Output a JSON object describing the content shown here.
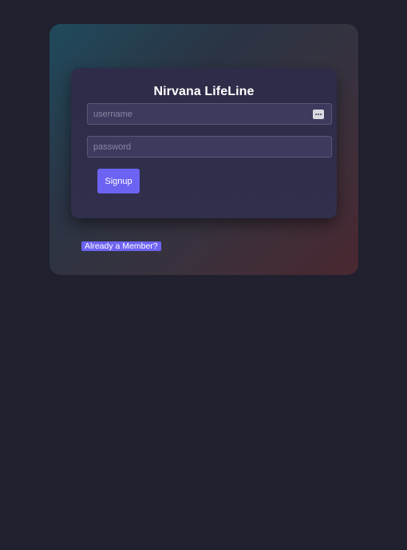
{
  "app": {
    "title": "Nirvana LifeLine"
  },
  "form": {
    "username_placeholder": "username",
    "password_placeholder": "password",
    "signup_label": "Signup",
    "member_link_label": "Already a Member?"
  },
  "icons": {
    "username_field_icon": "password-manager-key-icon"
  },
  "colors": {
    "page_background": "#20202e",
    "accent": "#6d63f2",
    "field_background": "#3d3b5d"
  }
}
